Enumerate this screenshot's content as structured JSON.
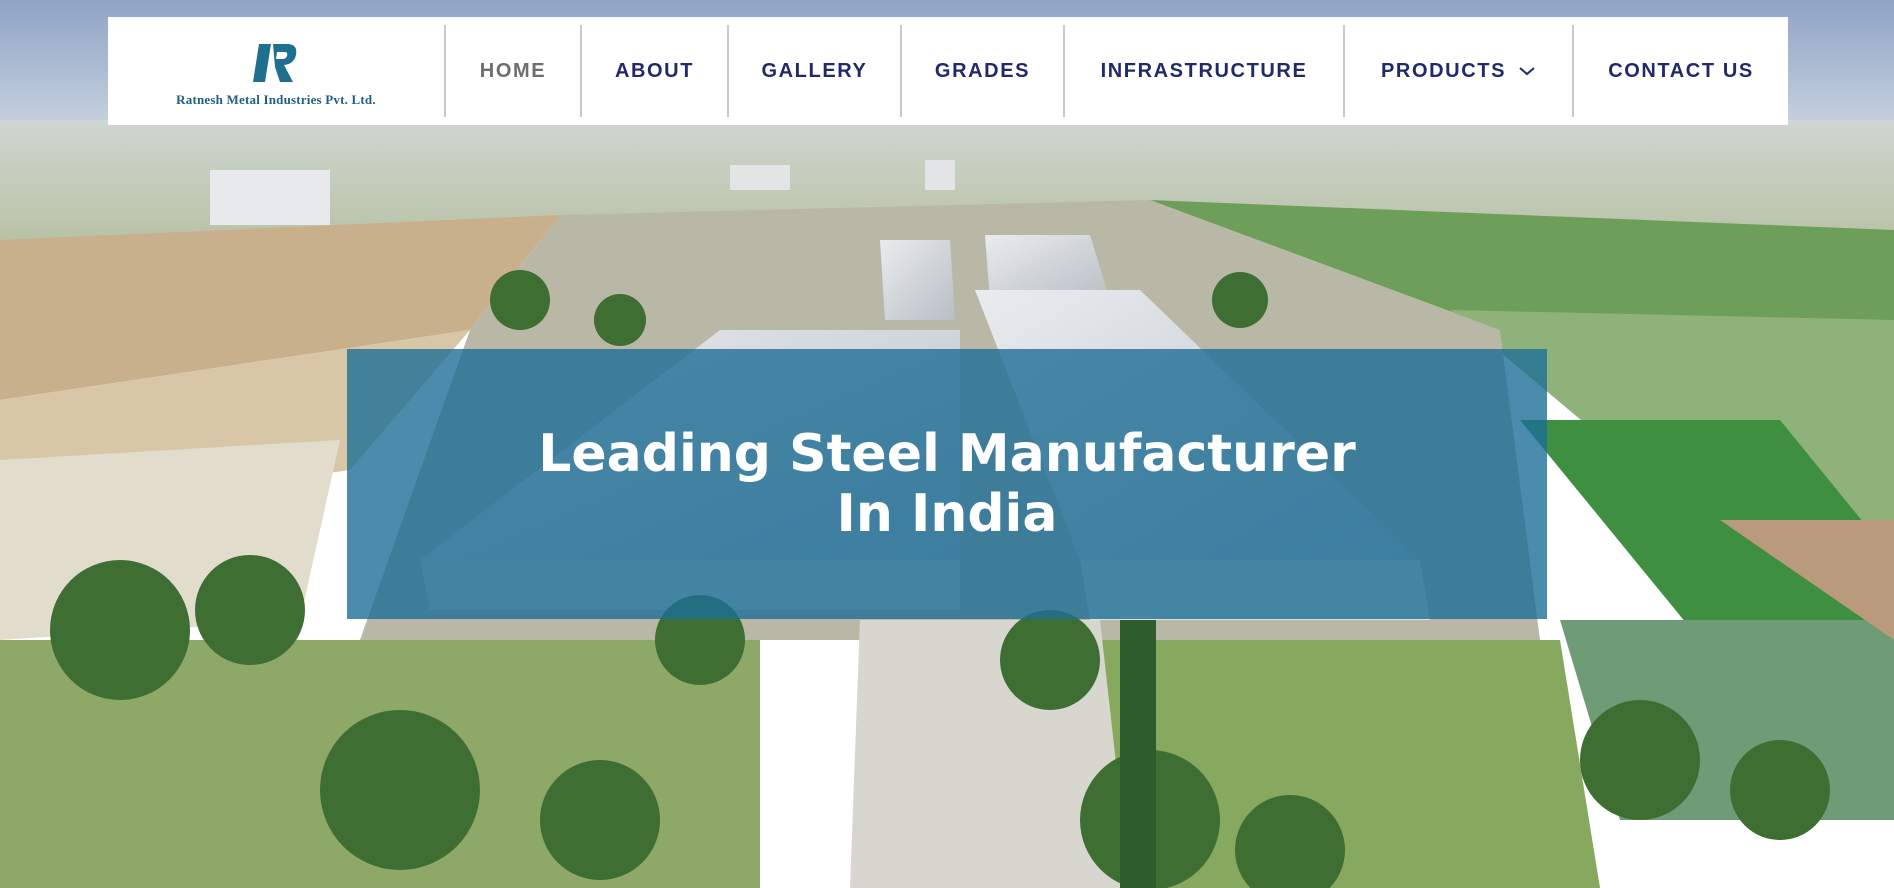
{
  "brand": {
    "company_name": "Ratnesh Metal Industries Pvt. Ltd.",
    "logo_icon": "r-monogram-logo",
    "brand_color": "#1f5f86"
  },
  "nav": {
    "items": [
      {
        "label": "HOME",
        "active": true
      },
      {
        "label": "ABOUT",
        "active": false
      },
      {
        "label": "GALLERY",
        "active": false
      },
      {
        "label": "GRADES",
        "active": false
      },
      {
        "label": "INFRASTRUCTURE",
        "active": false
      },
      {
        "label": "PRODUCTS",
        "active": false,
        "has_dropdown": true,
        "icon": "chevron-down-icon"
      },
      {
        "label": "CONTACT US",
        "active": false
      }
    ],
    "text_color": "#22296b",
    "active_color": "#6e6e6e"
  },
  "hero": {
    "headline_line1": "Leading Steel Manufacturer",
    "headline_line2": "In India",
    "overlay_color": "#1e6e96",
    "background_image": "aerial-factory-photo"
  }
}
